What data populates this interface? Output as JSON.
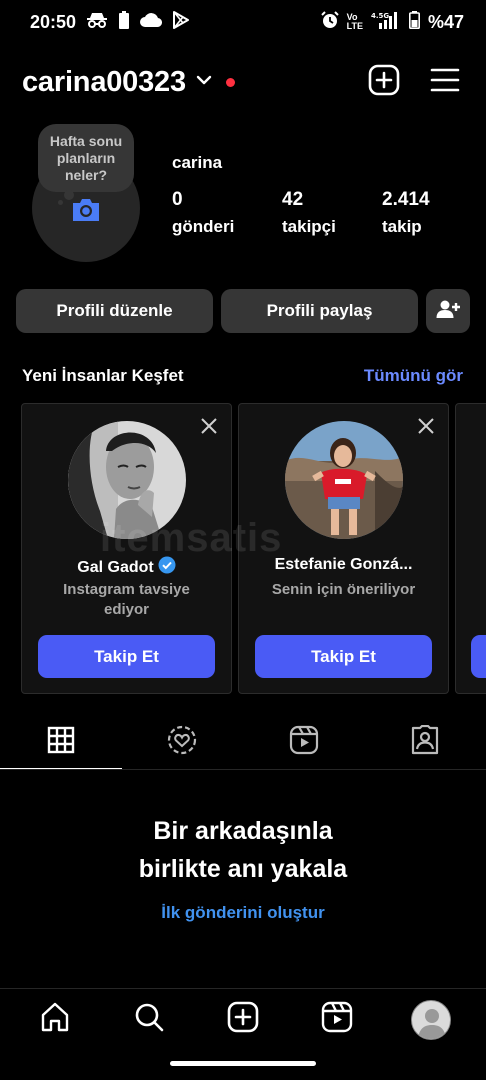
{
  "status_bar": {
    "time": "20:50",
    "battery_text": "%47",
    "signal_small_top": "Vo",
    "signal_small_bottom": "LTE",
    "net_small": "4.5G"
  },
  "header": {
    "username": "carina00323",
    "notification_dot_color": "#ff3040"
  },
  "profile": {
    "note_text": "Hafta sonu planların neler?",
    "display_name": "carina",
    "stats": [
      {
        "value": "0",
        "label": "gönderi"
      },
      {
        "value": "42",
        "label": "takipçi"
      },
      {
        "value": "2.414",
        "label": "takip"
      }
    ]
  },
  "actions": {
    "edit_profile": "Profili düzenle",
    "share_profile": "Profili paylaş"
  },
  "discover": {
    "title": "Yeni İnsanlar Keşfet",
    "see_all": "Tümünü gör",
    "cards": [
      {
        "name": "Gal Gadot",
        "verified": true,
        "subtitle": "Instagram tavsiye ediyor",
        "button": "Takip Et"
      },
      {
        "name": "Estefanie Gonzá...",
        "verified": false,
        "subtitle": "Senin için öneriliyor",
        "button": "Takip Et"
      }
    ]
  },
  "watermark": "itemsatis",
  "tabs": [
    "grid-icon",
    "reels-history-icon",
    "reels-icon",
    "tagged-icon"
  ],
  "empty_state": {
    "title_line1": "Bir arkadaşınla",
    "title_line2": "birlikte anı yakala",
    "link": "İlk gönderini oluştur"
  },
  "colors": {
    "accent": "#4a5bf5",
    "link": "#4192ef",
    "see_all": "#6b8aff"
  }
}
